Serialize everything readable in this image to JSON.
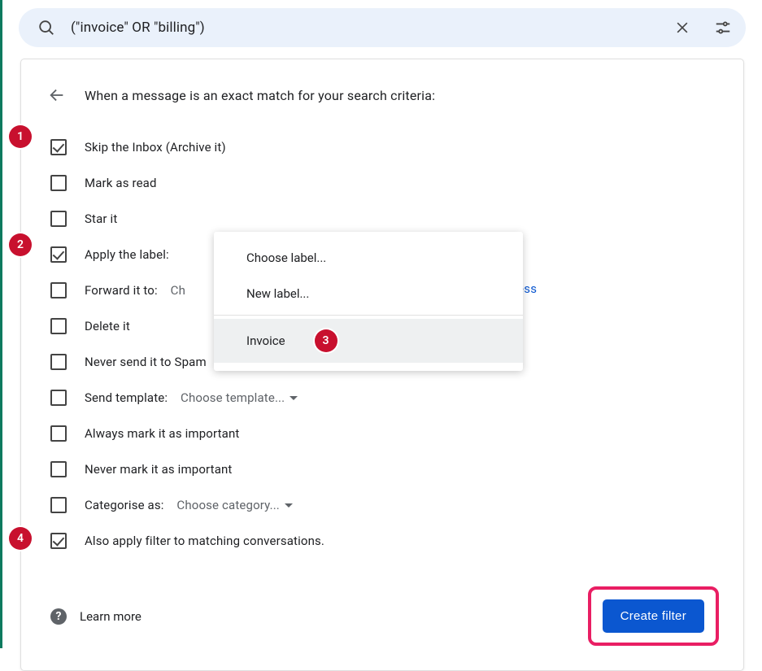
{
  "search": {
    "query": "(\"invoice\" OR \"billing\")"
  },
  "panel": {
    "header": "When a message is an exact match for your search criteria:"
  },
  "options": {
    "skip_inbox": "Skip the Inbox (Archive it)",
    "mark_read": "Mark as read",
    "star_it": "Star it",
    "apply_label": "Apply the label:",
    "forward_to": "Forward it to:",
    "forward_placeholder": "Ch",
    "delete_it": "Delete it",
    "never_spam": "Never send it to Spam",
    "send_template_label": "Send template:",
    "send_template_value": "Choose template...",
    "always_important": "Always mark it as important",
    "never_important": "Never mark it as important",
    "categorise_label": "Categorise as:",
    "categorise_value": "Choose category...",
    "also_apply": "Also apply filter to matching conversations."
  },
  "popup": {
    "choose_label": "Choose label...",
    "new_label": "New label...",
    "invoice": "Invoice"
  },
  "link_fragment": "ess",
  "footer": {
    "learn_more": "Learn more",
    "create_filter": "Create filter"
  },
  "badges": {
    "b1": "1",
    "b2": "2",
    "b3": "3",
    "b4": "4"
  },
  "side_chars": [
    "",
    "",
    "",
    "",
    "",
    "",
    "",
    "",
    "",
    ""
  ]
}
